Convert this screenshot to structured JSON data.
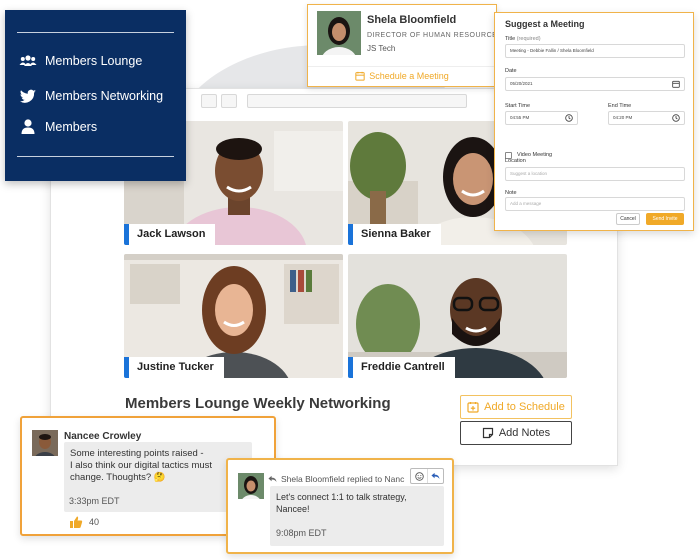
{
  "nav": {
    "items": [
      {
        "label": "Members Lounge",
        "icon": "users-icon"
      },
      {
        "label": "Members Networking",
        "icon": "twitter-icon"
      },
      {
        "label": "Members",
        "icon": "user-icon"
      }
    ]
  },
  "contact": {
    "name": "Shela Bloomfield",
    "role": "DIRECTOR OF HUMAN RESOURCES",
    "org": "JS Tech",
    "schedule_label": "Schedule a Meeting"
  },
  "dialog": {
    "title": "Suggest a Meeting",
    "title_label": "Title",
    "title_required": "(required)",
    "title_value": "Meeting - Debbie Fallin / Shela Bloomfield",
    "date_label": "Date",
    "date_value": "05/20/2021",
    "start_label": "Start Time",
    "start_value": "04:55 PM",
    "end_label": "End Time",
    "end_value": "04:20 PM",
    "video_label": "Video Meeting",
    "location_label": "Location",
    "location_placeholder": "Suggest a location",
    "note_label": "Note",
    "note_placeholder": "Add a message",
    "cancel_label": "Cancel",
    "send_label": "Send Invite"
  },
  "video": {
    "participants": [
      "Jack Lawson",
      "Sienna Baker",
      "Justine Tucker",
      "Freddie Cantrell"
    ]
  },
  "meeting": {
    "title": "Members Lounge Weekly Networking",
    "add_schedule_label": "Add to Schedule",
    "add_notes_label": "Add Notes"
  },
  "comment": {
    "author": "Nancee Crowley",
    "text_1": "Some interesting points raised -",
    "text_2": "I also think our digital tactics must",
    "text_3": "change. Thoughts? 🤔",
    "time": "3:33pm EDT",
    "likes": "40"
  },
  "reply": {
    "header": "Shela Bloomfield replied to Nanc",
    "text_1": "Let's connect 1:1 to talk strategy,",
    "text_2": "Nancee!",
    "time": "9:08pm EDT"
  },
  "colors": {
    "navy": "#0a2e63",
    "accent_orange": "#f0a928",
    "label_blue": "#1a73d9"
  }
}
